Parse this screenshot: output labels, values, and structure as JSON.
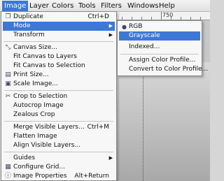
{
  "menubar": {
    "items": [
      {
        "label": "Image",
        "active": true
      },
      {
        "label": "Layer"
      },
      {
        "label": "Colors"
      },
      {
        "label": "Tools"
      },
      {
        "label": "Filters"
      },
      {
        "label": "Windows"
      },
      {
        "label": "Help"
      }
    ]
  },
  "ruler": {
    "label": "750"
  },
  "image_menu": {
    "items": [
      {
        "label": "Duplicate",
        "shortcut": "Ctrl+D",
        "icon": "duplicate-icon"
      },
      {
        "label": "Mode",
        "submenu": true,
        "highlighted": true
      },
      {
        "label": "Transform",
        "submenu": true
      },
      {
        "label": "Canvas Size...",
        "icon": "canvas-size-icon"
      },
      {
        "label": "Fit Canvas to Layers"
      },
      {
        "label": "Fit Canvas to Selection"
      },
      {
        "label": "Print Size...",
        "icon": "print-size-icon"
      },
      {
        "label": "Scale Image...",
        "icon": "scale-image-icon"
      },
      {
        "label": "Crop to Selection",
        "icon": "crop-icon"
      },
      {
        "label": "Autocrop Image"
      },
      {
        "label": "Zealous Crop"
      },
      {
        "label": "Merge Visible Layers...",
        "shortcut": "Ctrl+M"
      },
      {
        "label": "Flatten Image"
      },
      {
        "label": "Align Visible Layers..."
      },
      {
        "label": "Guides",
        "submenu": true
      },
      {
        "label": "Configure Grid...",
        "icon": "grid-icon"
      },
      {
        "label": "Image Properties",
        "shortcut": "Alt+Return",
        "icon": "info-icon"
      }
    ]
  },
  "mode_submenu": {
    "items": [
      {
        "label": "RGB",
        "selected": true
      },
      {
        "label": "Grayscale",
        "highlighted": true
      },
      {
        "label": "Indexed..."
      },
      {
        "label": "Assign Color Profile..."
      },
      {
        "label": "Convert to Color Profile..."
      }
    ]
  },
  "colors": {
    "highlight": "#3d78d4",
    "menu_bg": "#f7f7f7"
  }
}
